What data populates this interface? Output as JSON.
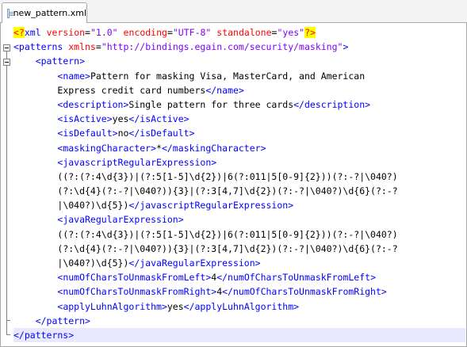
{
  "tab": {
    "label": "new_pattern.xml",
    "icon": "xml-file-icon"
  },
  "code": {
    "decl": {
      "open": "<?",
      "name": "xml",
      "version_attr": "version",
      "version_val": "\"1.0\"",
      "encoding_attr": "encoding",
      "encoding_val": "\"UTF-8\"",
      "standalone_attr": "standalone",
      "standalone_val": "\"yes\"",
      "close": "?>"
    },
    "patterns_open": "<patterns",
    "xmlns_attr": "xmlns",
    "xmlns_val": "\"http://bindings.egain.com/security/masking\"",
    "patterns_gt": ">",
    "pattern_open": "<pattern>",
    "name_open": "<name>",
    "name_text_1": "Pattern for masking Visa, MasterCard, and American",
    "name_text_2": "Express credit card numbers",
    "name_close": "</name>",
    "description_open": "<description>",
    "description_text": "Single pattern for three cards",
    "description_close": "</description>",
    "isActive_open": "<isActive>",
    "isActive_text": "yes",
    "isActive_close": "</isActive>",
    "isDefault_open": "<isDefault>",
    "isDefault_text": "no",
    "isDefault_close": "</isDefault>",
    "maskingChar_open": "<maskingCharacter>",
    "maskingChar_text": "*",
    "maskingChar_close": "</maskingCharacter>",
    "jsRegex_open": "<javascriptRegularExpression>",
    "jsRegex_1": "((?:(?:4\\d{3})|(?:5[1-5]\\d{2})|6(?:011|5[0-9]{2}))(?:-?|\\040?)",
    "jsRegex_2": "(?:\\d{4}(?:-?|\\040?)){3}|(?:3[4,7]\\d{2})(?:-?|\\040?)\\d{6}(?:-?",
    "jsRegex_3": "|\\040?)\\d{5})",
    "jsRegex_close": "</javascriptRegularExpression>",
    "javaRegex_open": "<javaRegularExpression>",
    "javaRegex_1": "((?:(?:4\\d{3})|(?:5[1-5]\\d{2})|6(?:011|5[0-9]{2}))(?:-?|\\040?)",
    "javaRegex_2": "(?:\\d{4}(?:-?|\\040?)){3}|(?:3[4,7]\\d{2})(?:-?|\\040?)\\d{6}(?:-?",
    "javaRegex_3": "|\\040?)\\d{5})",
    "javaRegex_close": "</javaRegularExpression>",
    "numLeft_open": "<numOfCharsToUnmaskFromLeft>",
    "numLeft_text": "4",
    "numLeft_close": "</numOfCharsToUnmaskFromLeft>",
    "numRight_open": "<numOfCharsToUnmaskFromRight>",
    "numRight_text": "4",
    "numRight_close": "</numOfCharsToUnmaskFromRight>",
    "luhn_open": "<applyLuhnAlgorithm>",
    "luhn_text": "yes",
    "luhn_close": "</applyLuhnAlgorithm>",
    "pattern_close": "</pattern>",
    "patterns_close": "</patterns>"
  },
  "colors": {
    "tag": "#0000ff",
    "attribute": "#ff0000",
    "attribute_value": "#8000ff",
    "pi_highlight": "#ffff00",
    "current_line": "#e8e8ff"
  }
}
